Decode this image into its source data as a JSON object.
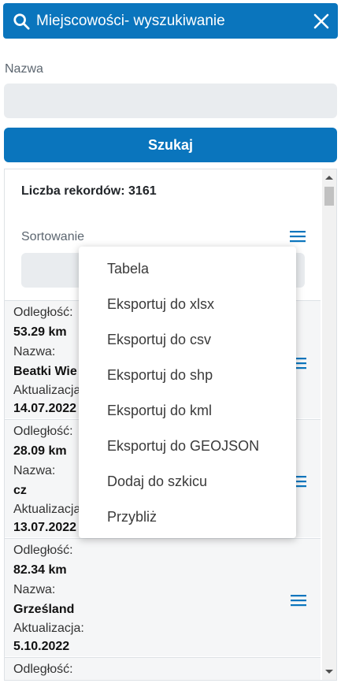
{
  "header": {
    "title": "Miejscowości- wyszukiwanie",
    "search_icon": "search-icon",
    "close_icon": "close-icon",
    "color": "#0a75bd"
  },
  "form": {
    "name_label": "Nazwa",
    "name_value": "",
    "search_button": "Szukaj"
  },
  "results": {
    "record_count": "Liczba rekordów: 3161",
    "sort_label": "Sortowanie",
    "rows": [
      {
        "distance_label": "Odległość:",
        "distance": "53.29 km",
        "name_label": "Nazwa:",
        "name": "Beatki Wie",
        "updated_label": "Aktualizacja:",
        "updated": "14.07.2022"
      },
      {
        "distance_label": "Odległość:",
        "distance": "28.09 km",
        "name_label": "Nazwa:",
        "name": "cz",
        "updated_label": "Aktualizacja:",
        "updated": "13.07.2022"
      },
      {
        "distance_label": "Odległość:",
        "distance": "82.34 km",
        "name_label": "Nazwa:",
        "name": "Grześland",
        "updated_label": "Aktualizacja:",
        "updated": "5.10.2022"
      },
      {
        "distance_label": "Odległość:"
      }
    ]
  },
  "dropdown": {
    "items": [
      "Tabela",
      "Eksportuj do xlsx",
      "Eksportuj do csv",
      "Eksportuj do shp",
      "Eksportuj do kml",
      "Eksportuj do GEOJSON",
      "Dodaj do szkicu",
      "Przybliż"
    ]
  }
}
